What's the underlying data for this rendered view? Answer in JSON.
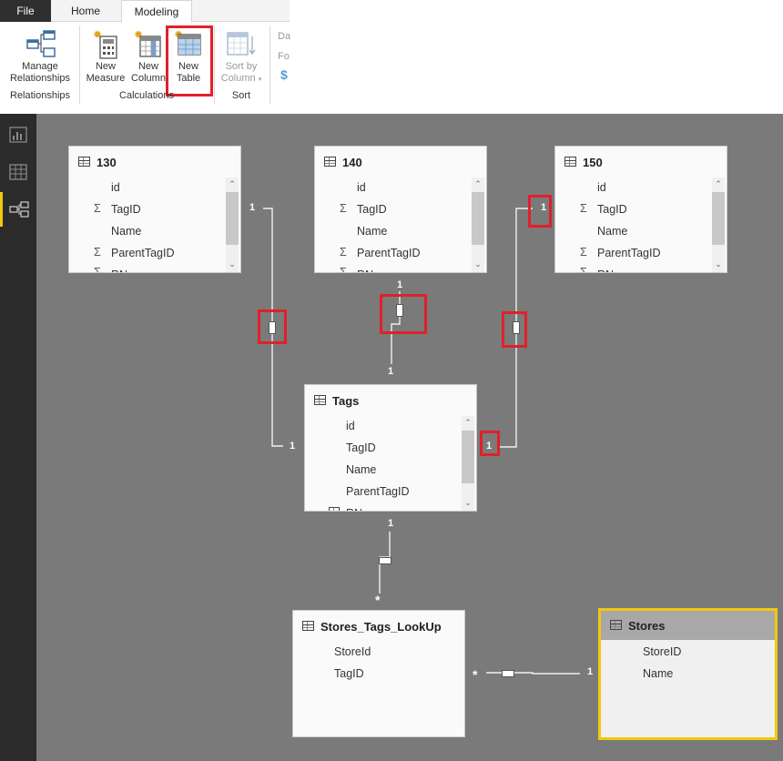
{
  "ribbon": {
    "tabs": {
      "file": "File",
      "home": "Home",
      "modeling": "Modeling"
    },
    "buttons": {
      "manage_relationships_1": "Manage",
      "manage_relationships_2": "Relationships",
      "new_measure_1": "New",
      "new_measure_2": "Measure",
      "new_column_1": "New",
      "new_column_2": "Column",
      "new_table_1": "New",
      "new_table_2": "Table",
      "sort_by_column_1": "Sort by",
      "sort_by_column_2": "Column",
      "truncated_1": "Da",
      "truncated_2": "Fo",
      "truncated_3": "$"
    },
    "groups": {
      "relationships": "Relationships",
      "calculations": "Calculations",
      "sort": "Sort"
    }
  },
  "tables": {
    "t130": {
      "title": "130",
      "fields": [
        "id",
        "TagID",
        "Name",
        "ParentTagID",
        "RN"
      ]
    },
    "t140": {
      "title": "140",
      "fields": [
        "id",
        "TagID",
        "Name",
        "ParentTagID",
        "RN"
      ]
    },
    "t150": {
      "title": "150",
      "fields": [
        "id",
        "TagID",
        "Name",
        "ParentTagID",
        "RN"
      ]
    },
    "tags": {
      "title": "Tags",
      "fields": [
        "id",
        "TagID",
        "Name",
        "ParentTagID",
        "RN"
      ]
    },
    "lookup": {
      "title": "Stores_Tags_LookUp",
      "fields": [
        "StoreId",
        "TagID"
      ]
    },
    "stores": {
      "title": "Stores",
      "fields": [
        "StoreID",
        "Name"
      ]
    }
  },
  "relationships": {
    "one": "1",
    "many": "*"
  },
  "colors": {
    "highlight": "#e0202a",
    "selected_border": "#f2c811",
    "canvas": "#7a7a7a"
  }
}
